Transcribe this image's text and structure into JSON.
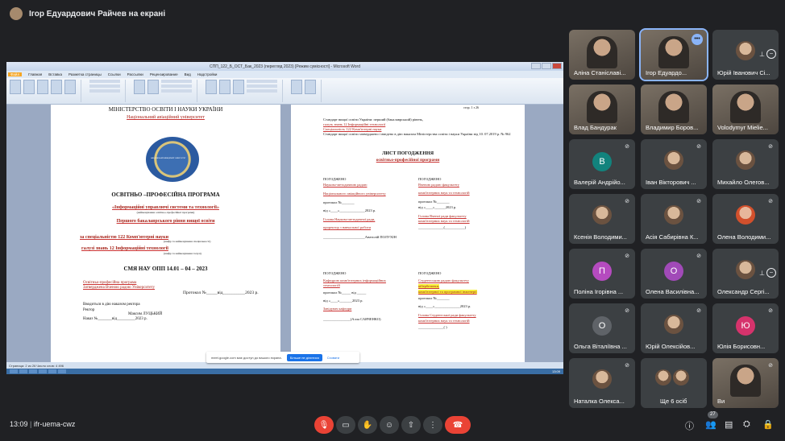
{
  "topbar": {
    "presenter_label": "Ігор Едуардович Райчев на екрані"
  },
  "word": {
    "title": "СПП_122_Б_ОСТ_Бак_2023 (перегляд 2023) [Режим сумісності] - Microsoft Word",
    "tabs": [
      "Файл",
      "Главная",
      "Вставка",
      "Разметка страницы",
      "Ссылки",
      "Рассылки",
      "Рецензирование",
      "Вид",
      "Надстройки"
    ],
    "active_tab": "Вид",
    "status": "Страница: 2 из 26   Число слов: 4 496",
    "clock": "13:09"
  },
  "doc_page1": {
    "ministry": "МІНІСТЕРСТВО ОСВІТИ І НАУКИ УКРАЇНИ",
    "university": "Національний авіаційний університет",
    "logo_text": "НАЦІОНАЛЬНИЙ АВІАЦІЙНИЙ УНІВЕРСИТЕТ",
    "program_type": "ОСВІТНЬО –ПРОФЕСІЙНА ПРОГРАМА",
    "program_name": "«Інформаційні управлючі системи та технології»",
    "program_name_note": "(найменування освітньо-професійної програми)",
    "level": "Першого бакалаврського рівня вищої освіти",
    "specialty": "за спеціальністю 122 Комп'ютерні науки",
    "specialty_note": "(шифр та найменування спеціальності)",
    "field": "галузі знань   12 Інформаційні технології",
    "field_note": "(шифр та найменування галузі)",
    "code": "СМЯ НАУ ОПП 14.01 – 04 – 2023",
    "approved_1": "Освітньо-професійна програма",
    "approved_2": "Затверджена Вченою радою Університету",
    "protocol": "Протокол №_____від__________2023 р.",
    "enacted": "Вводиться в дію наказом ректора",
    "rector": "Ректор",
    "rector_name": "Максим ЛУЦЬКИЙ",
    "order": "Наказ №_______від_________2023 р."
  },
  "doc_page2": {
    "header_note": "стор. 1 з 26",
    "standard_1": "Стандарт вищої освіти України: перший (бакалаврський) рівень,",
    "standard_2": "галузь знань   12 Інформаційні технології",
    "standard_3": "Спеціальність   122 Комп'ютерні науки",
    "standard_4": "Стандарт вищої освіти затверджено і введено в дію наказом Міністерства освіти і науки України від 10. 07.2019 р.  № 962",
    "sheet_title": "ЛИСТ ПОГОДЖЕННЯ",
    "sheet_subtitle": "освітньо-професійної програми",
    "left_block_1": [
      "ПОГОДЖЕНО",
      "Науково-методичною радою",
      "Національного авіаційного університету",
      "протокол №_______",
      "від «____»______________2023 р.",
      "Голова Науково-методичної ради,",
      "проректор з навчальної роботи",
      "_______________________Анатолій ПОЛУХІН"
    ],
    "right_block_1": [
      "ПОГОДЖЕНО",
      "Вченою радою факультету",
      "комп'ютерних наук та технологій",
      "протокол №_______",
      "від «____»______2023 р.",
      "Голова Вченої ради факультету",
      "комп'ютерних наук та технологій",
      "______________(___________)"
    ],
    "left_block_2": [
      "ПОГОДЖЕНО",
      "Кафедрою комп'ютерних інформаційних",
      "технологій",
      "протокол №_____ від _____",
      "від «____»_______2023 р.",
      "Завідувач кафедри",
      "_______________(Алла САВЧЕНКО)"
    ],
    "right_block_2": [
      "ПОГОДЖЕНО",
      "Студентською радою факультету",
      "кібербезпеки,",
      "комп'ютерної та програмної інженерії",
      "протокол №_______",
      "від «____»______________2023 р.",
      "Голова Студентської ради факультету",
      "комп'ютерних наук та технологій",
      "______________(           )"
    ]
  },
  "popup": {
    "text": "meet.google.com має доступ до вашого екрана.",
    "button": "Більше не ділитися",
    "link": "Сховати"
  },
  "participants": [
    {
      "name": "Аліна Станіславі...",
      "kind": "video"
    },
    {
      "name": "Ігор Едуардо...",
      "kind": "video",
      "selected": true
    },
    {
      "name": "Юрій Іванович Сі...",
      "kind": "avatar-photo"
    },
    {
      "name": "Влад Бандурак",
      "kind": "video"
    },
    {
      "name": "Владимир Боров...",
      "kind": "video"
    },
    {
      "name": "Volodymyr Mielie...",
      "kind": "video"
    },
    {
      "name": "Валерій Андрійо...",
      "kind": "letter",
      "letter": "В",
      "color": "#12837d"
    },
    {
      "name": "Іван Вікторович ...",
      "kind": "avatar-photo"
    },
    {
      "name": "Михайло Олегов...",
      "kind": "avatar-photo"
    },
    {
      "name": "Ксенія Володими...",
      "kind": "avatar-photo"
    },
    {
      "name": "Асія Сабирівна К...",
      "kind": "avatar-photo"
    },
    {
      "name": "Олена Володими...",
      "kind": "avatar-photo"
    },
    {
      "name": "Поліна Ігорівна ...",
      "kind": "letter",
      "letter": "П",
      "color": "#b54bbf"
    },
    {
      "name": "Олена Василівна...",
      "kind": "letter",
      "letter": "О",
      "color": "#a14ab8"
    },
    {
      "name": "Олександр Сергі...",
      "kind": "avatar-photo"
    },
    {
      "name": "Ольга Віталіївна ...",
      "kind": "letter",
      "letter": "О",
      "color": "#5f6368"
    },
    {
      "name": "Юрій Олексійов...",
      "kind": "avatar-photo"
    },
    {
      "name": "Юлія Борисовн...",
      "kind": "letter",
      "letter": "Ю",
      "color": "#d6336c"
    },
    {
      "name": "Наталка Олекса...",
      "kind": "avatar-photo"
    },
    {
      "name": "Ще 6 осіб",
      "kind": "group"
    },
    {
      "name": "Ви",
      "kind": "video"
    }
  ],
  "bottombar": {
    "time": "13:09",
    "separator": "|",
    "meeting_code": "ifr-uema-cwz",
    "participant_count": "27"
  }
}
